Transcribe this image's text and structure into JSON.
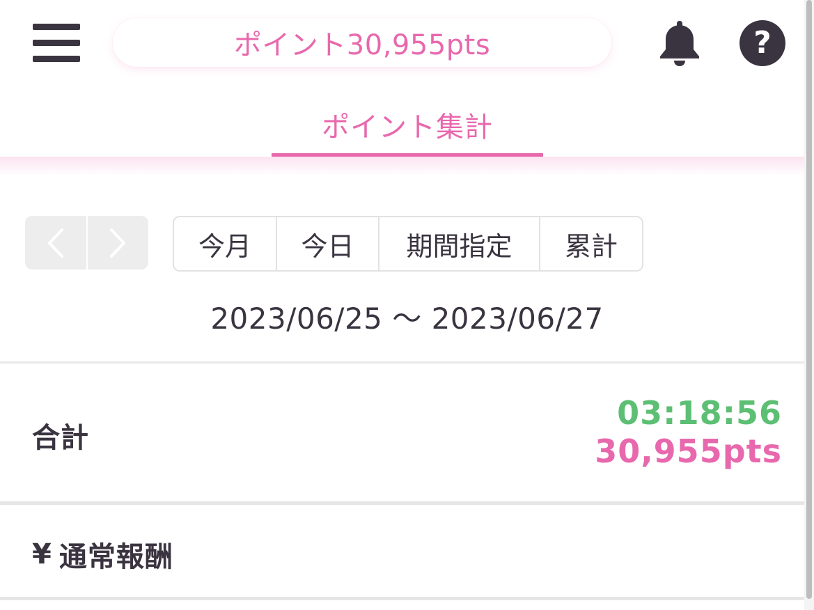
{
  "header": {
    "menu_icon": "hamburger-menu-icon",
    "points_pill": "ポイント30,955pts",
    "bell_icon": "bell-icon",
    "help_icon": "question-circle-icon",
    "help_glyph": "?"
  },
  "tabs": [
    {
      "label": "ポイント集計",
      "active": true
    }
  ],
  "controls": {
    "prev_icon": "chevron-left-icon",
    "next_icon": "chevron-right-icon",
    "segments": [
      "今月",
      "今日",
      "期間指定",
      "累計"
    ]
  },
  "date_range": "2023/06/25 〜 2023/06/27",
  "summary": {
    "label": "合計",
    "time": "03:18:56",
    "points": "30,955pts"
  },
  "reward": {
    "icon_glyph": "¥",
    "icon": "yen-icon",
    "label": "通常報酬"
  },
  "colors": {
    "accent_pink": "#e868ad",
    "accent_green": "#5cbf73",
    "text_dark": "#3a3440"
  }
}
